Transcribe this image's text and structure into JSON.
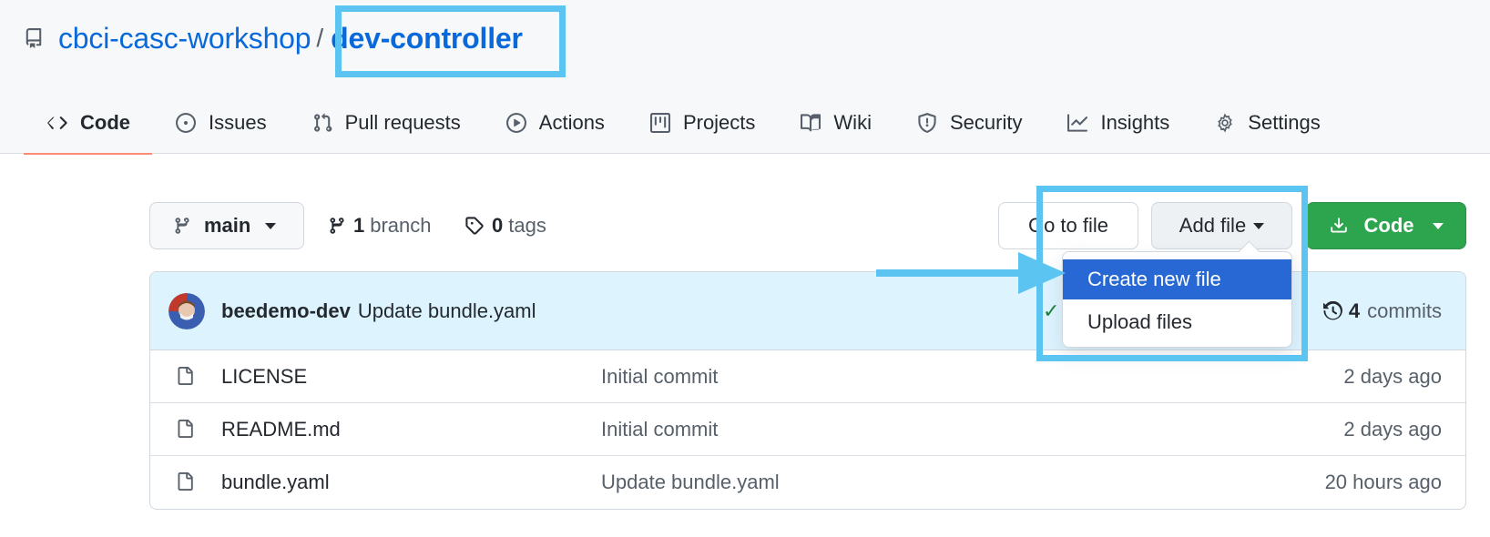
{
  "repo": {
    "owner": "cbci-casc-workshop",
    "separator": "/",
    "name": "dev-controller"
  },
  "tabs": [
    {
      "label": "Code",
      "icon": "code-icon"
    },
    {
      "label": "Issues",
      "icon": "issue-icon"
    },
    {
      "label": "Pull requests",
      "icon": "pull-request-icon"
    },
    {
      "label": "Actions",
      "icon": "play-icon"
    },
    {
      "label": "Projects",
      "icon": "project-icon"
    },
    {
      "label": "Wiki",
      "icon": "book-icon"
    },
    {
      "label": "Security",
      "icon": "shield-icon"
    },
    {
      "label": "Insights",
      "icon": "graph-icon"
    },
    {
      "label": "Settings",
      "icon": "gear-icon"
    }
  ],
  "toolbar": {
    "branch": "main",
    "branch_count": "1",
    "branch_label": "branch",
    "tag_count": "0",
    "tag_label": "tags",
    "goto_label": "Go to file",
    "add_file_label": "Add file",
    "code_label": "Code"
  },
  "dropdown": {
    "items": [
      "Create new file",
      "Upload files"
    ]
  },
  "latest_commit": {
    "author": "beedemo-dev",
    "message": "Update bundle.yaml",
    "commit_count": "4",
    "commit_label": "commits"
  },
  "files": [
    {
      "name": "LICENSE",
      "commit": "Initial commit",
      "age": "2 days ago"
    },
    {
      "name": "README.md",
      "commit": "Initial commit",
      "age": "2 days ago"
    },
    {
      "name": "bundle.yaml",
      "commit": "Update bundle.yaml",
      "age": "20 hours ago"
    }
  ],
  "colors": {
    "link": "#0969da",
    "highlight": "#5bc4f0",
    "menu_active": "#2868d4",
    "code_button": "#2da44e",
    "active_tab_underline": "#fd8c73"
  }
}
